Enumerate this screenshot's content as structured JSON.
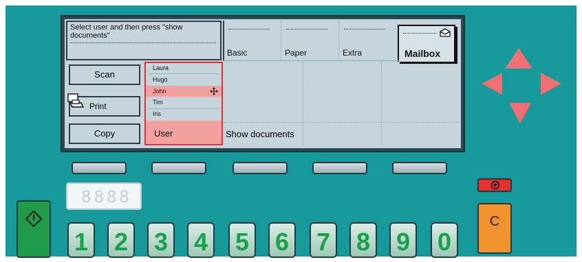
{
  "screen": {
    "prompt": "Select user and then press \"show documents\"",
    "tabs": [
      {
        "label": "Basic"
      },
      {
        "label": "Paper"
      },
      {
        "label": "Extra"
      },
      {
        "label": "Mailbox"
      }
    ],
    "menu": [
      {
        "label": "Scan"
      },
      {
        "label": "Print"
      },
      {
        "label": "Copy"
      }
    ],
    "users": [
      "Laura",
      "Hugo",
      "John",
      "Tim",
      "Iris"
    ],
    "selected_user": "John",
    "user_label": "User",
    "show_documents_label": "Show documents"
  },
  "display": {
    "counter": "8888"
  },
  "keys": {
    "clear_label": "C",
    "digits": [
      "1",
      "2",
      "3",
      "4",
      "5",
      "6",
      "7",
      "8",
      "9",
      "0"
    ]
  },
  "colors": {
    "panel": "#17999c",
    "highlight": "#f2a0a0",
    "selection_border": "#e0303a",
    "start_button": "#1e9a4a",
    "clear_button": "#f0932e",
    "digit_text": "#18a04a",
    "arrow": "#ef6f73"
  },
  "icons": {
    "start": "start-diamond-icon",
    "stop": "stop-icon",
    "print": "printer-icon",
    "mailbox": "mailbox-icon",
    "move": "move-cursor-icon"
  }
}
